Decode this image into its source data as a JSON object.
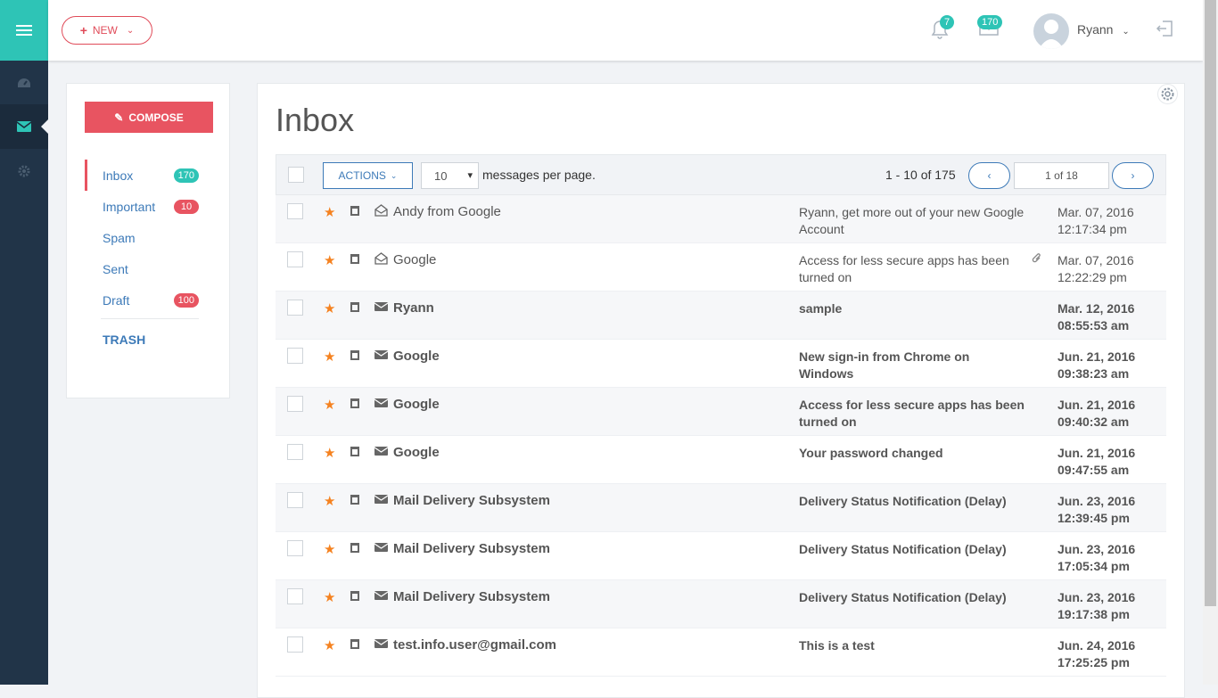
{
  "topbar": {
    "new_label": "NEW",
    "notification_count": "7",
    "mail_count": "170",
    "user_name": "Ryann"
  },
  "sidebar": {
    "compose_label": "COMPOSE",
    "folders": [
      {
        "label": "Inbox",
        "badge": "170",
        "badge_color": "#2ec4b6"
      },
      {
        "label": "Important",
        "badge": "10",
        "badge_color": "#e85461"
      },
      {
        "label": "Spam",
        "badge": ""
      },
      {
        "label": "Sent",
        "badge": ""
      },
      {
        "label": "Draft",
        "badge": "100",
        "badge_color": "#e85461"
      }
    ],
    "trash_label": "TRASH"
  },
  "main": {
    "title": "Inbox",
    "actions_label": "ACTIONS",
    "per_page_value": "10",
    "per_page_label": "messages per page.",
    "range_text": "1 - 10 of 175",
    "prev_label": "‹",
    "next_label": "›",
    "page_input": "1 of 18"
  },
  "messages": [
    {
      "sender": "Andy from Google",
      "subject": "Ryann, get more out of your new Google Account",
      "date": "Mar. 07, 2016",
      "time": "12:17:34 pm",
      "read": true,
      "attachment": false
    },
    {
      "sender": "Google",
      "subject": "Access for less secure apps has been turned on",
      "date": "Mar. 07, 2016",
      "time": "12:22:29 pm",
      "read": true,
      "attachment": true
    },
    {
      "sender": "Ryann",
      "subject": "sample",
      "date": "Mar. 12, 2016",
      "time": "08:55:53 am",
      "read": false,
      "attachment": false
    },
    {
      "sender": "Google",
      "subject": "New sign-in from Chrome on Windows",
      "date": "Jun. 21, 2016",
      "time": "09:38:23 am",
      "read": false,
      "attachment": false
    },
    {
      "sender": "Google",
      "subject": "Access for less secure apps has been turned on",
      "date": "Jun. 21, 2016",
      "time": "09:40:32 am",
      "read": false,
      "attachment": false
    },
    {
      "sender": "Google",
      "subject": "Your password changed",
      "date": "Jun. 21, 2016",
      "time": "09:47:55 am",
      "read": false,
      "attachment": false
    },
    {
      "sender": "Mail Delivery Subsystem",
      "subject": "Delivery Status Notification (Delay)",
      "date": "Jun. 23, 2016",
      "time": "12:39:45 pm",
      "read": false,
      "attachment": false
    },
    {
      "sender": "Mail Delivery Subsystem",
      "subject": "Delivery Status Notification (Delay)",
      "date": "Jun. 23, 2016",
      "time": "17:05:34 pm",
      "read": false,
      "attachment": false
    },
    {
      "sender": "Mail Delivery Subsystem",
      "subject": "Delivery Status Notification (Delay)",
      "date": "Jun. 23, 2016",
      "time": "19:17:38 pm",
      "read": false,
      "attachment": false
    },
    {
      "sender": "test.info.user@gmail.com",
      "subject": "This is a test",
      "date": "Jun. 24, 2016",
      "time": "17:25:25 pm",
      "read": false,
      "attachment": false
    }
  ]
}
